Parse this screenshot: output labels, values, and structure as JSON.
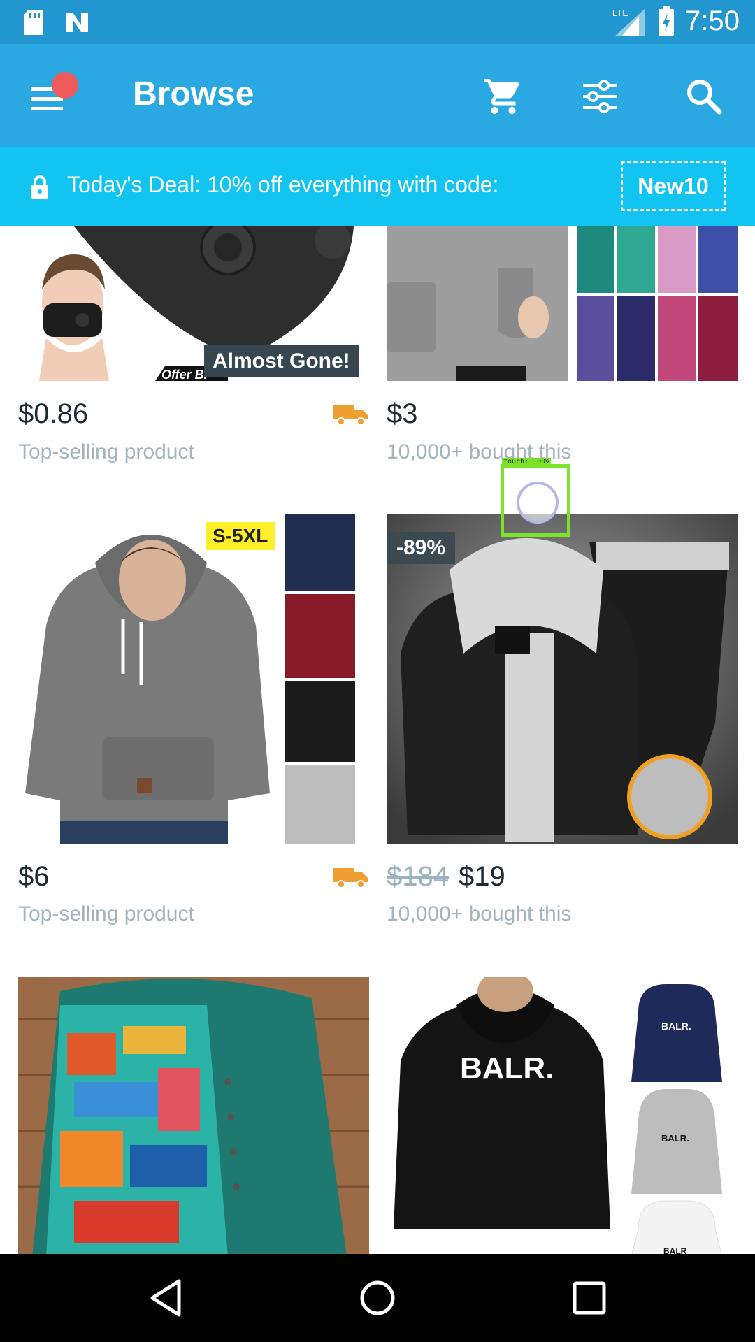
{
  "status_bar": {
    "time": "7:50",
    "network": "LTE",
    "icons": [
      "sd-card-icon",
      "n-logo-icon",
      "lte-signal-icon",
      "battery-charging-icon"
    ]
  },
  "app_bar": {
    "title": "Browse",
    "icons": [
      "menu-icon",
      "cart-icon",
      "filter-icon",
      "search-icon"
    ],
    "accent_color": "#2aa8e2"
  },
  "deal_banner": {
    "text": "Today's Deal: 10% off everything with code:",
    "code": "New10",
    "color": "#12c4f2"
  },
  "products": [
    {
      "price": "$0.86",
      "subtitle": "Top-selling product",
      "badge": "Almost Gone!",
      "fast_shipping": true,
      "image_text": "Offer Bi"
    },
    {
      "price": "$3",
      "subtitle": "10,000+ bought this",
      "fast_shipping": false
    },
    {
      "price": "$6",
      "subtitle": "Top-selling product",
      "badge": "S-5XL",
      "fast_shipping": true
    },
    {
      "price_old": "$184",
      "price": "$19",
      "subtitle": "10,000+ bought this",
      "badge": "-89%",
      "fast_shipping": false
    },
    {
      "description": "patchwork-blouse"
    },
    {
      "brand_text": "BALR.",
      "thumb_text": "BALR.",
      "thumb_text2": "BALR.",
      "thumb_text3": "BALR"
    }
  ],
  "touch_indicator": {
    "label": "touch: 100%"
  },
  "nav_bar": {
    "icons": [
      "back-icon",
      "home-icon",
      "recents-icon"
    ]
  }
}
